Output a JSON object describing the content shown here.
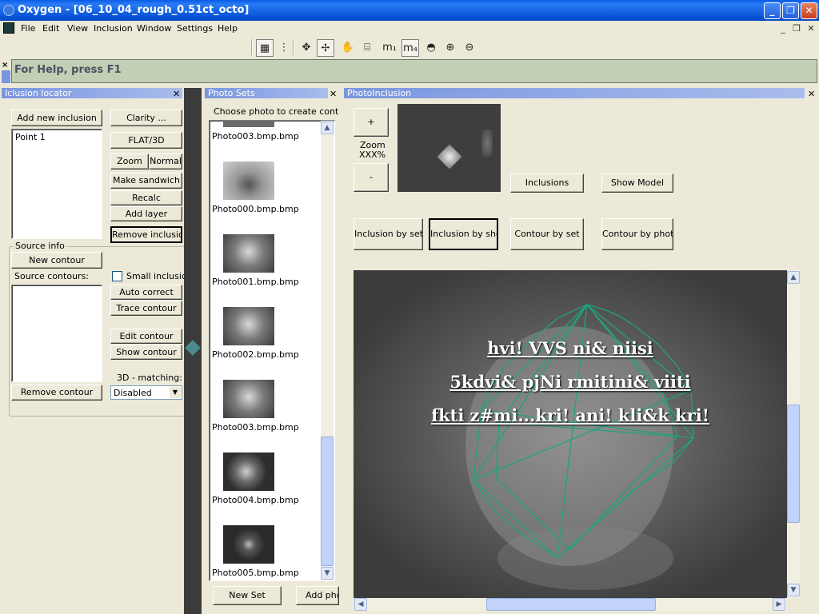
{
  "window": {
    "title": "Oxygen - [06_10_04_rough_0.51ct_octo]"
  },
  "menu": [
    "File",
    "Edit",
    "View",
    "Inclusion",
    "Window",
    "Settings",
    "Help"
  ],
  "help_text": "For Help, press F1",
  "panels": {
    "locator": {
      "title": "Iclusion locator",
      "add_inclusion": "Add new inclusion",
      "inclusions": [
        "Point 1"
      ],
      "clarity": "Clarity ...",
      "flat3d": "FLAT/3D",
      "zoom": "Zoom",
      "normal": "Normal",
      "make_sandwich": "Make sandwich",
      "recalc": "Recalc",
      "add_layer": "Add layer",
      "remove_inclusion": "Remove inclusion",
      "source_info": "Source info",
      "new_contour": "New contour",
      "source_contours": "Source contours:",
      "small_inclusion": "Small inclusion",
      "auto_correct": "Auto correct",
      "trace_contour": "Trace contour",
      "edit_contour": "Edit contour",
      "show_contour": "Show contour",
      "matching_label": "3D - matching:",
      "matching_value": "Disabled",
      "remove_contour": "Remove contour"
    },
    "photosets": {
      "title": "Photo Sets",
      "instruction": "Choose photo to create contour on",
      "photos": [
        "Photo003.bmp.bmp",
        "Photo000.bmp.bmp",
        "Photo001.bmp.bmp",
        "Photo002.bmp.bmp",
        "Photo003.bmp.bmp",
        "Photo004.bmp.bmp",
        "Photo005.bmp.bmp"
      ],
      "new_set": "New Set",
      "add_photo": "Add pho"
    },
    "photoinclusion": {
      "title": "PhotoInclusion",
      "plus": "+",
      "zoom_label": "Zoom",
      "zoom_value": "XXX%",
      "minus": "-",
      "inclusions": "Inclusions",
      "show_model": "Show Model",
      "inclusion_by_set": "Inclusion by set",
      "inclusion_by_shot": "Inclusion by shot",
      "contour_by_set": "Contour by set",
      "contour_by_photo": "Contour by photo",
      "overlay": [
        "hvi! VVS ni& niisi",
        "5kdvi& pjNi rmitini& viiti",
        "fkti z#mi...kri! ani! kli&k kri!"
      ]
    }
  },
  "colors": {
    "title_blue": "#0a5ce8",
    "help_green": "#c3cfb5",
    "panel_title": "#7a96df",
    "model_wire": "#1fa37f"
  }
}
